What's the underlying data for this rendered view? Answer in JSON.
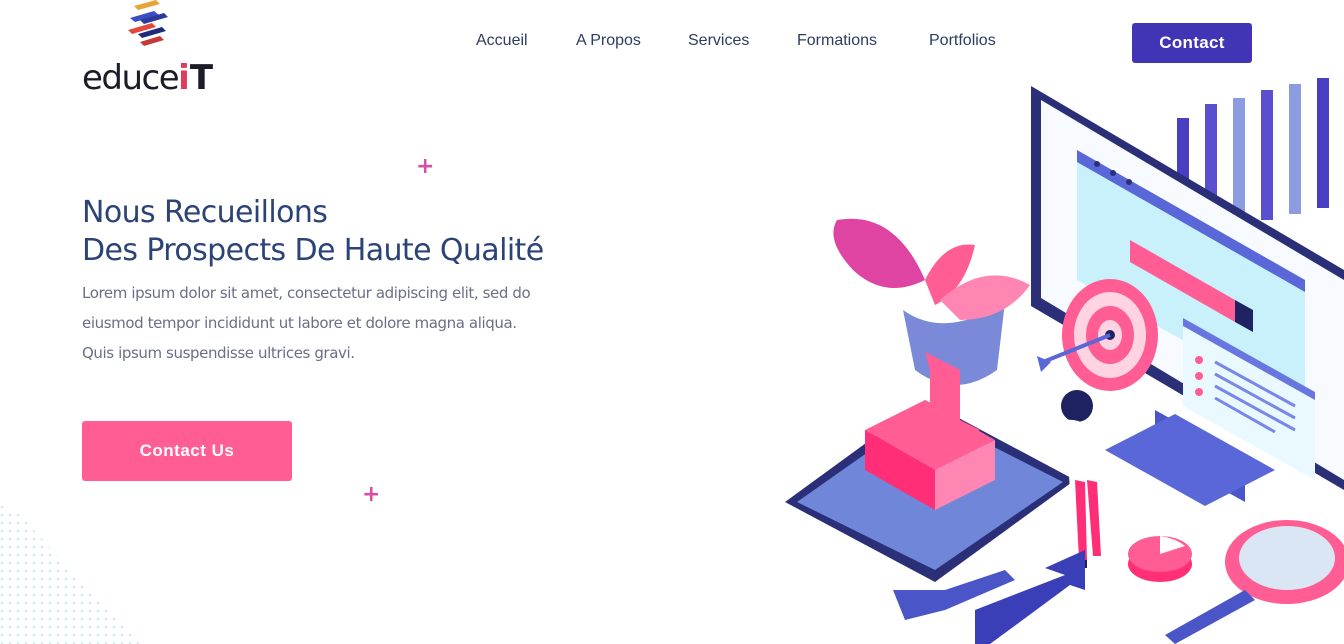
{
  "brand": {
    "name_main": "educe",
    "name_i": "i",
    "name_t": "T"
  },
  "nav": {
    "items": [
      "Accueil",
      "A Propos",
      "Services",
      "Formations",
      "Portfolios"
    ],
    "contact_label": "Contact"
  },
  "hero": {
    "title_line1": "Nous Recueillons",
    "title_line2": "Des Prospects De Haute Qualité",
    "text_line1": "Lorem ipsum dolor sit amet, consectetur adipiscing elit, sed do",
    "text_line2": "eiusmod tempor incididunt ut labore et dolore magna aliqua.",
    "text_line3": "Quis ipsum suspendisse ultrices gravi.",
    "cta_label": "Contact Us"
  },
  "colors": {
    "primary": "#4135b5",
    "accent": "#ff5d93",
    "heading": "#2c4377",
    "body_text": "#6a6f85",
    "plus": "#d44fa6"
  },
  "icons": [
    "logo-mark-icon",
    "plus-icon",
    "hero-illustration"
  ]
}
